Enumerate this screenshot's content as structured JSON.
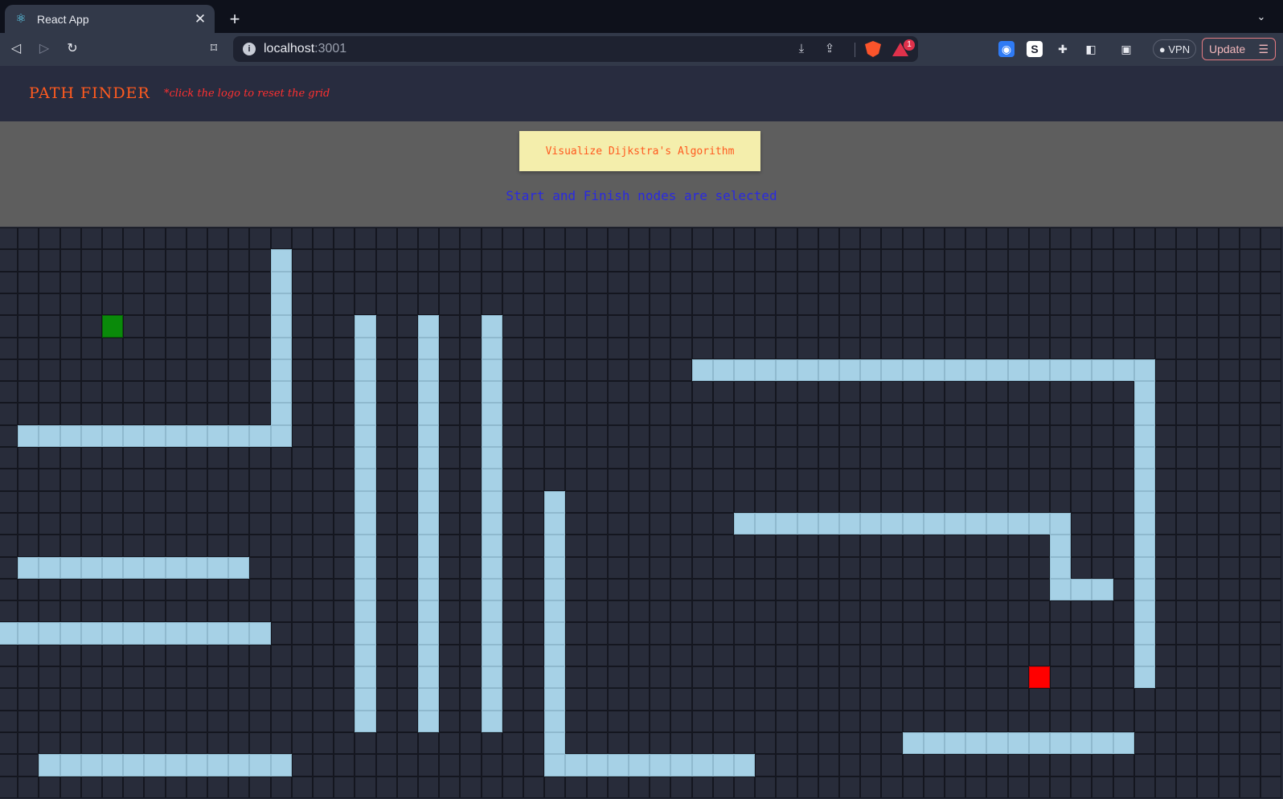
{
  "browser": {
    "tab_title": "React App",
    "tab_icon": "react-icon",
    "url_host": "localhost",
    "url_port": ":3001",
    "vpn_label": "VPN",
    "update_label": "Update",
    "rewards_badge": "1"
  },
  "app": {
    "logo": "PATH FINDER",
    "hint": "*click the logo to reset the grid",
    "visualize_label": "Visualize Dijkstra's Algorithm",
    "status": "Start and Finish nodes are selected"
  },
  "grid": {
    "rows": 26,
    "cols": 61,
    "start": [
      4,
      5
    ],
    "finish": [
      20,
      49
    ],
    "walls": [
      {
        "r": [
          1,
          9
        ],
        "c": [
          13,
          13
        ]
      },
      {
        "r": [
          9,
          9
        ],
        "c": [
          1,
          13
        ]
      },
      {
        "r": [
          4,
          22
        ],
        "c": [
          17,
          17
        ]
      },
      {
        "r": [
          4,
          22
        ],
        "c": [
          20,
          20
        ]
      },
      {
        "r": [
          4,
          22
        ],
        "c": [
          23,
          23
        ]
      },
      {
        "r": [
          12,
          23
        ],
        "c": [
          26,
          26
        ]
      },
      {
        "r": [
          24,
          24
        ],
        "c": [
          26,
          35
        ]
      },
      {
        "r": [
          6,
          6
        ],
        "c": [
          33,
          54
        ]
      },
      {
        "r": [
          6,
          20
        ],
        "c": [
          54,
          54
        ]
      },
      {
        "r": [
          13,
          13
        ],
        "c": [
          35,
          50
        ]
      },
      {
        "r": [
          13,
          16
        ],
        "c": [
          50,
          50
        ]
      },
      {
        "r": [
          16,
          16
        ],
        "c": [
          50,
          52
        ]
      },
      {
        "r": [
          15,
          15
        ],
        "c": [
          1,
          11
        ]
      },
      {
        "r": [
          18,
          18
        ],
        "c": [
          0,
          12
        ]
      },
      {
        "r": [
          24,
          24
        ],
        "c": [
          2,
          13
        ]
      },
      {
        "r": [
          23,
          23
        ],
        "c": [
          43,
          53
        ]
      }
    ],
    "colors": {
      "empty": "#282c3a",
      "wall": "#a6d1e6",
      "start": "#0a8a0a",
      "finish": "#ff0000"
    }
  }
}
